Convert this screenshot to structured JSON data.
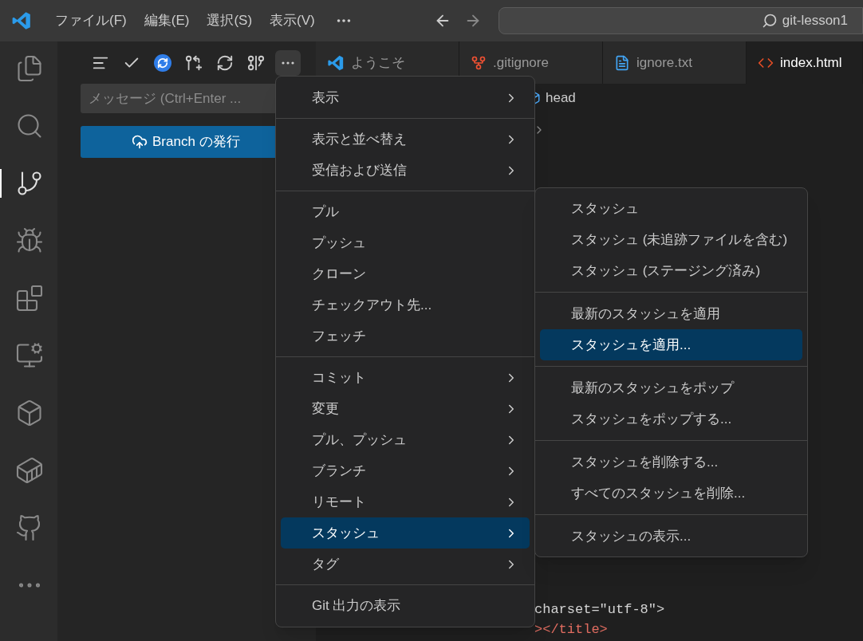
{
  "title_bar": {
    "menus": [
      "ファイル(F)",
      "編集(E)",
      "選択(S)",
      "表示(V)"
    ],
    "search": "git-lesson1"
  },
  "scm": {
    "message_placeholder": "メッセージ (Ctrl+Enter ...",
    "publish_button": "Branch の発行"
  },
  "tabs": [
    {
      "label": "ようこそ",
      "kind": "welcome",
      "selected": false
    },
    {
      "label": ".gitignore",
      "kind": "git",
      "selected": false
    },
    {
      "label": "ignore.txt",
      "kind": "text",
      "selected": false
    },
    {
      "label": "index.html",
      "kind": "html",
      "selected": true
    }
  ],
  "breadcrumb": "head",
  "code_lines": [
    {
      "text": "charset=\"utf-8\">",
      "kind": "attr"
    },
    {
      "text": "></title>",
      "kind": "tag"
    }
  ],
  "menu": [
    [
      {
        "label": "表示",
        "submenu": true,
        "selected": false
      }
    ],
    [
      {
        "label": "表示と並べ替え",
        "submenu": true,
        "selected": false
      },
      {
        "label": "受信および送信",
        "submenu": true,
        "selected": false
      }
    ],
    [
      {
        "label": "プル",
        "submenu": false,
        "selected": false
      },
      {
        "label": "プッシュ",
        "submenu": false,
        "selected": false
      },
      {
        "label": "クローン",
        "submenu": false,
        "selected": false
      },
      {
        "label": "チェックアウト先...",
        "submenu": false,
        "selected": false
      },
      {
        "label": "フェッチ",
        "submenu": false,
        "selected": false
      }
    ],
    [
      {
        "label": "コミット",
        "submenu": true,
        "selected": false
      },
      {
        "label": "変更",
        "submenu": true,
        "selected": false
      },
      {
        "label": "プル、プッシュ",
        "submenu": true,
        "selected": false
      },
      {
        "label": "ブランチ",
        "submenu": true,
        "selected": false
      },
      {
        "label": "リモート",
        "submenu": true,
        "selected": false
      },
      {
        "label": "スタッシュ",
        "submenu": true,
        "selected": true
      },
      {
        "label": "タグ",
        "submenu": true,
        "selected": false
      }
    ],
    [
      {
        "label": "Git 出力の表示",
        "submenu": false,
        "selected": false
      }
    ]
  ],
  "submenu": [
    [
      {
        "label": "スタッシュ",
        "selected": false
      },
      {
        "label": "スタッシュ (未追跡ファイルを含む)",
        "selected": false
      },
      {
        "label": "スタッシュ (ステージング済み)",
        "selected": false
      }
    ],
    [
      {
        "label": "最新のスタッシュを適用",
        "selected": false
      },
      {
        "label": "スタッシュを適用...",
        "selected": true
      }
    ],
    [
      {
        "label": "最新のスタッシュをポップ",
        "selected": false
      },
      {
        "label": "スタッシュをポップする...",
        "selected": false
      }
    ],
    [
      {
        "label": "スタッシュを削除する...",
        "selected": false
      },
      {
        "label": "すべてのスタッシュを削除...",
        "selected": false
      }
    ],
    [
      {
        "label": "スタッシュの表示...",
        "selected": false
      }
    ]
  ]
}
